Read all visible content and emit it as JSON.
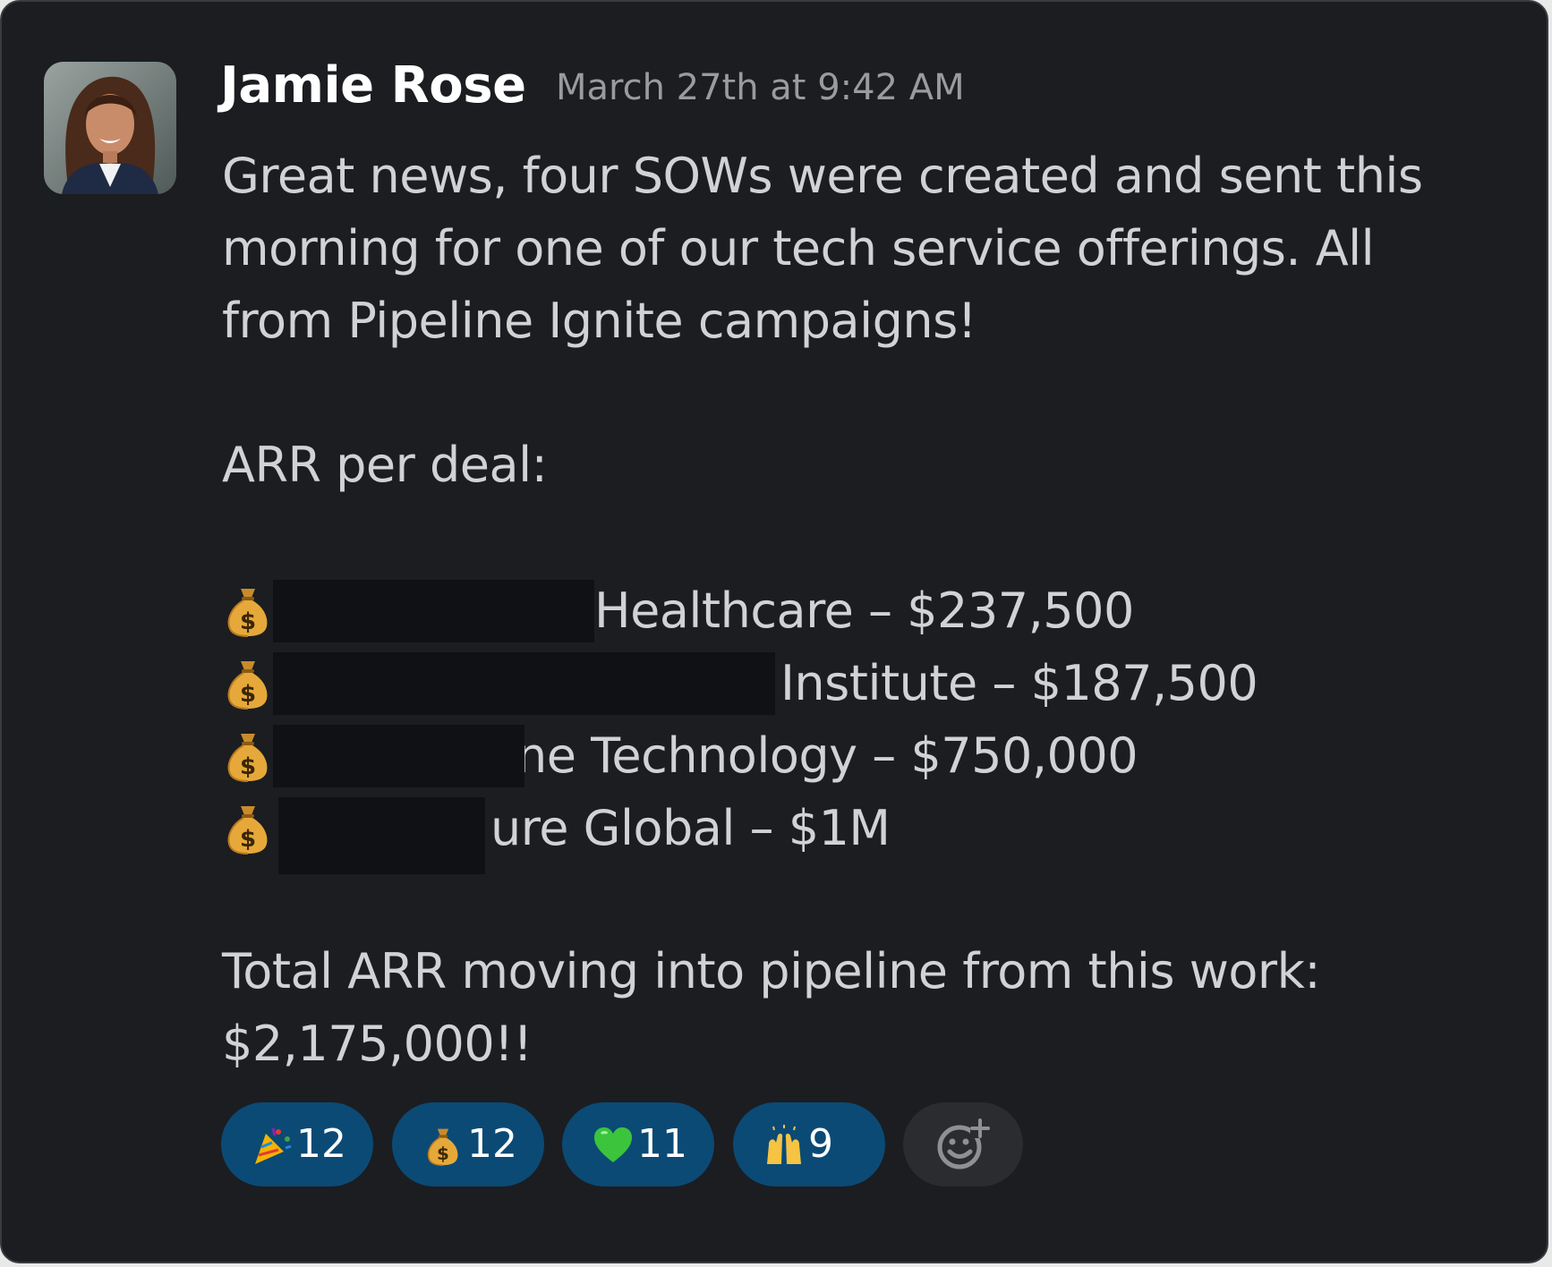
{
  "message": {
    "author": "Jamie Rose",
    "timestamp": "March 27th at 9:42 AM",
    "lines": [
      "Great news, four SOWs were created and sent this",
      "morning for one of our tech service offerings. All",
      "from Pipeline Ignite campaigns!",
      "ARR per deal:"
    ],
    "deals": [
      {
        "icon": "money-bag-icon",
        "text": "Healthcare – $237,500"
      },
      {
        "icon": "money-bag-icon",
        "text": "Institute – $187,500"
      },
      {
        "icon": "money-bag-icon",
        "text": "ne Technology  – $750,000"
      },
      {
        "icon": "money-bag-icon",
        "text": "ure Global – $1M"
      }
    ],
    "total_line_1": "Total ARR moving into pipeline from this work:",
    "total_line_2": "$2,175,000!!"
  },
  "reactions": [
    {
      "icon": "party-popper-icon",
      "count": "12"
    },
    {
      "icon": "money-bag-icon",
      "count": "12"
    },
    {
      "icon": "green-heart-icon",
      "count": "11"
    },
    {
      "icon": "raised-hands-icon",
      "count": "9"
    }
  ],
  "colors": {
    "background": "#1b1d21",
    "reaction_pill": "#0b4a75",
    "text": "#d1d2d3",
    "timestamp": "#9a9b9e"
  }
}
